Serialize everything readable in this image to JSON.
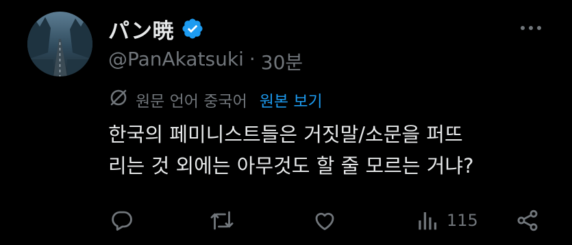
{
  "tweet": {
    "display_name": "パン暁",
    "handle": "@PanAkatsuki",
    "separator": "·",
    "time": "30분",
    "translation": {
      "note": "원문 언어 중국어",
      "view_original": "원본 보기"
    },
    "text": "한국의 페미니스트들은 거짓말/소문을 퍼뜨\n리는 것 외에는 아무것도 할 줄 모르는 거냐?",
    "stats": {
      "views": "115"
    }
  },
  "colors": {
    "background": "#000000",
    "text": "#e7e9ea",
    "muted": "#71767b",
    "accent": "#1d9bf0"
  },
  "icons": {
    "verified": "verified-badge-icon",
    "more": "more-icon",
    "translate": "translate-icon",
    "reply": "reply-icon",
    "retweet": "retweet-icon",
    "like": "like-icon",
    "views": "views-icon",
    "share": "share-icon"
  }
}
